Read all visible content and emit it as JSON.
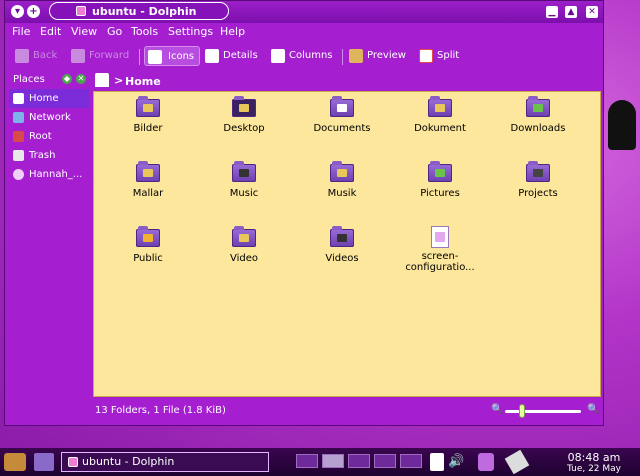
{
  "window": {
    "title": "ubuntu - Dolphin",
    "controls": [
      "minimize",
      "maximize",
      "close"
    ]
  },
  "menubar": [
    "File",
    "Edit",
    "View",
    "Go",
    "Tools",
    "Settings",
    "Help"
  ],
  "toolbar": {
    "back_label": "Back",
    "forward_label": "Forward",
    "icons_label": "Icons",
    "details_label": "Details",
    "columns_label": "Columns",
    "preview_label": "Preview",
    "split_label": "Split"
  },
  "places": {
    "header": "Places",
    "items": [
      {
        "label": "Home",
        "icon": "home-icon",
        "active": true
      },
      {
        "label": "Network",
        "icon": "network-icon"
      },
      {
        "label": "Root",
        "icon": "root-folder-icon"
      },
      {
        "label": "Trash",
        "icon": "trash-icon"
      },
      {
        "label": "Hannah_...",
        "icon": "drive-icon"
      }
    ]
  },
  "location": {
    "crumb": "Home"
  },
  "files": [
    {
      "name": "Bilder",
      "type": "folder"
    },
    {
      "name": "Desktop",
      "type": "folder"
    },
    {
      "name": "Documents",
      "type": "folder"
    },
    {
      "name": "Dokument",
      "type": "folder"
    },
    {
      "name": "Downloads",
      "type": "folder"
    },
    {
      "name": "Mallar",
      "type": "folder"
    },
    {
      "name": "Music",
      "type": "folder"
    },
    {
      "name": "Musik",
      "type": "folder"
    },
    {
      "name": "Pictures",
      "type": "folder"
    },
    {
      "name": "Projects",
      "type": "folder"
    },
    {
      "name": "Public",
      "type": "folder"
    },
    {
      "name": "Video",
      "type": "folder"
    },
    {
      "name": "Videos",
      "type": "folder"
    },
    {
      "name": "screen-configuratio...",
      "type": "file"
    }
  ],
  "status": {
    "text": "13 Folders, 1 File (1.8 KiB)",
    "zoom_level": 0.2
  },
  "taskbar": {
    "task_label": "ubuntu - Dolphin",
    "time": "08:48 am",
    "date": "Tue, 22 May"
  },
  "colors": {
    "window_bg": "#a51fd0",
    "view_bg": "#fce79d",
    "taskbar_bg": "#2a0440"
  }
}
